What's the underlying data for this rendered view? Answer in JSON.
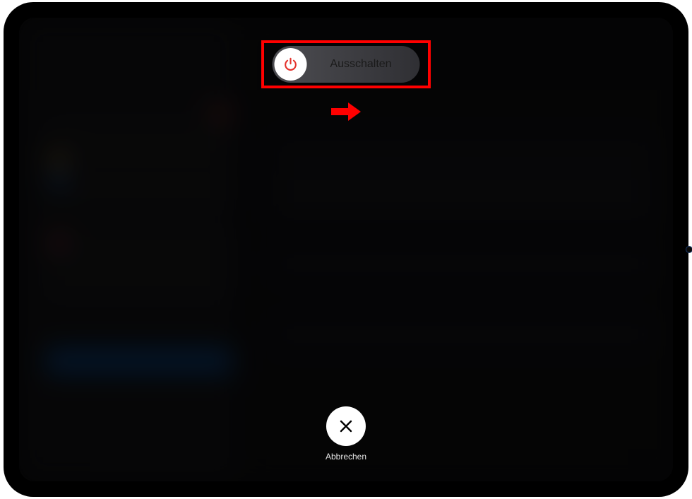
{
  "slider": {
    "label": "Ausschalten",
    "icon_name": "power-icon"
  },
  "cancel": {
    "label": "Abbrechen",
    "icon_name": "close-icon"
  },
  "annotation": {
    "arrow_direction": "right",
    "highlight_color": "#ff0000"
  }
}
